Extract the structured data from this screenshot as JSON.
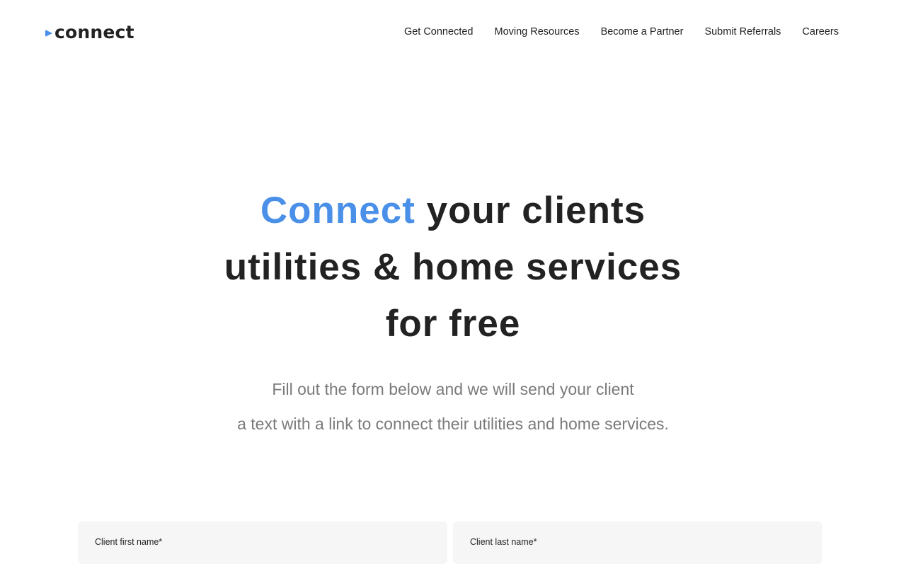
{
  "header": {
    "logo_text": "connect",
    "nav": [
      {
        "label": "Get Connected"
      },
      {
        "label": "Moving Resources"
      },
      {
        "label": "Become a Partner"
      },
      {
        "label": "Submit Referrals"
      },
      {
        "label": "Careers"
      }
    ]
  },
  "hero": {
    "title_accent": "Connect",
    "title_line1_rest": " your clients",
    "title_line2": "utilities & home services",
    "title_line3": "for free",
    "subtitle_line1": "Fill out the form below and we will send your client",
    "subtitle_line2": "a text with a link to connect their utilities and home services."
  },
  "form": {
    "first_name_label": "Client first name*",
    "first_name_value": "",
    "last_name_label": "Client last name*",
    "last_name_value": ""
  },
  "colors": {
    "accent": "#4a90e8",
    "text_dark": "#222222",
    "text_muted": "#7a7a7a",
    "field_bg": "#f6f6f6"
  },
  "icons": {
    "logo_mark": "play-triangle-icon"
  }
}
